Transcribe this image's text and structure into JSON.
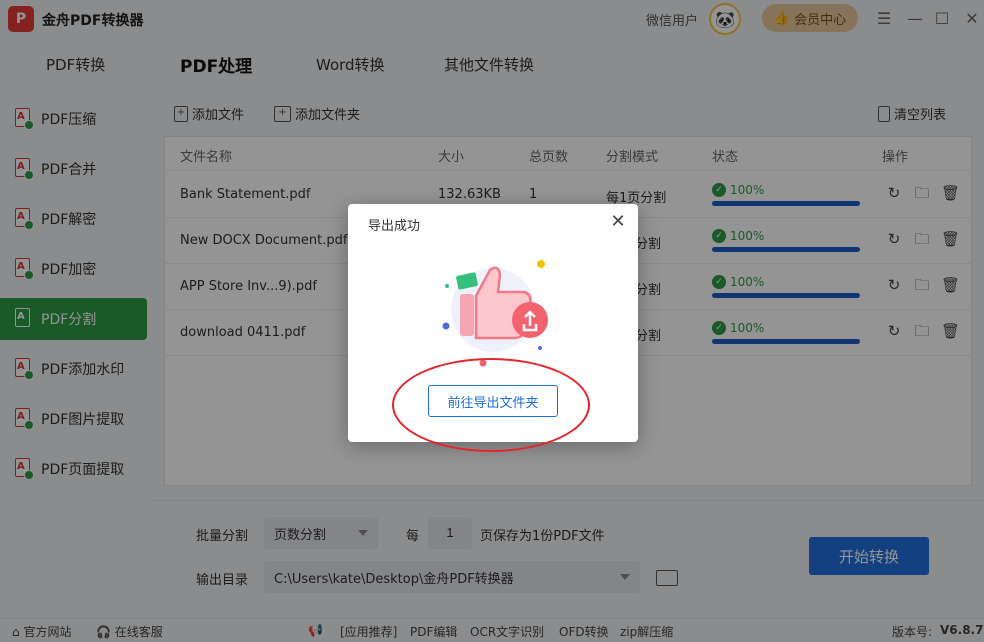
{
  "app": {
    "title": "金舟PDF转换器",
    "logo_letter": "P",
    "user_name": "微信用户",
    "vip_label": "会员中心"
  },
  "top_tabs": [
    {
      "label": "PDF转换",
      "active": false
    },
    {
      "label": "PDF处理",
      "active": true
    },
    {
      "label": "Word转换",
      "active": false
    },
    {
      "label": "其他文件转换",
      "active": false
    }
  ],
  "sidebar": {
    "items": [
      {
        "label": "PDF压缩",
        "active": false
      },
      {
        "label": "PDF合并",
        "active": false
      },
      {
        "label": "PDF解密",
        "active": false
      },
      {
        "label": "PDF加密",
        "active": false
      },
      {
        "label": "PDF分割",
        "active": true
      },
      {
        "label": "PDF添加水印",
        "active": false
      },
      {
        "label": "PDF图片提取",
        "active": false
      },
      {
        "label": "PDF页面提取",
        "active": false
      }
    ]
  },
  "toolbar": {
    "add_file": "添加文件",
    "add_folder": "添加文件夹",
    "clear_list": "清空列表"
  },
  "table": {
    "headers": [
      "文件名称",
      "大小",
      "总页数",
      "分割模式",
      "状态",
      "操作"
    ],
    "rows": [
      {
        "name": "Bank Statement.pdf",
        "size": "132.63KB",
        "pages": "1",
        "mode": "每1页分割",
        "status": "100%",
        "progress": 1.0
      },
      {
        "name": "New DOCX Document.pdf",
        "size": "",
        "pages": "",
        "mode": "分割",
        "status": "100%",
        "progress": 1.0
      },
      {
        "name": "APP Store Inv...9).pdf",
        "size": "",
        "pages": "",
        "mode": "分割",
        "status": "100%",
        "progress": 1.0
      },
      {
        "name": "download 0411.pdf",
        "size": "",
        "pages": "",
        "mode": "分割",
        "status": "100%",
        "progress": 1.0
      }
    ]
  },
  "bottom": {
    "batch_label": "批量分割",
    "split_mode_value": "页数分割",
    "per_label": "每",
    "per_value": "1",
    "per_suffix": "页保存为1份PDF文件",
    "output_label": "输出目录",
    "output_path": "C:\\Users\\kate\\Desktop\\金舟PDF转换器",
    "start_label": "开始转换"
  },
  "statusbar": {
    "official_site": "官方网站",
    "online_service": "在线客服",
    "recommend": "[应用推荐]",
    "links": [
      "PDF编辑",
      "OCR文字识别",
      "OFD转换",
      "zip解压缩"
    ],
    "version_label": "版本号:",
    "version": "V6.8.7"
  },
  "dialog": {
    "title": "导出成功",
    "close_glyph": "✕",
    "button_label": "前往导出文件夹"
  },
  "colors": {
    "accent_green": "#2e9a46",
    "accent_blue": "#1f6fdc",
    "progress_blue": "#1e5cc4",
    "annotation_red": "#e3262b"
  }
}
